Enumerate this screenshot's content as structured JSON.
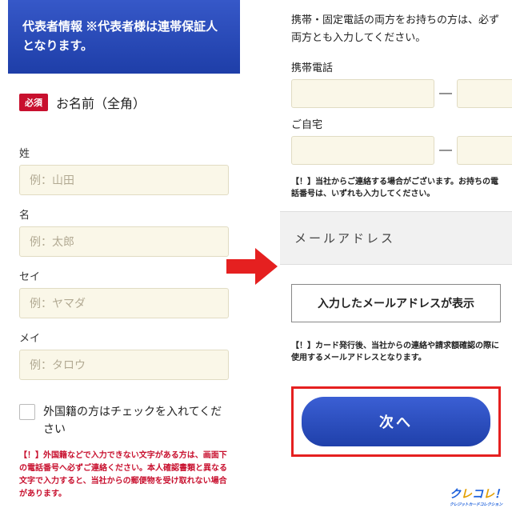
{
  "left": {
    "header": "代表者情報 ※代表者様は連帯保証人となります。",
    "required_badge": "必須",
    "section_title": "お名前（全角）",
    "fields": {
      "sei": {
        "label": "姓",
        "placeholder": "例：山田"
      },
      "mei": {
        "label": "名",
        "placeholder": "例：太郎"
      },
      "seikana": {
        "label": "セイ",
        "placeholder": "例：ヤマダ"
      },
      "meikana": {
        "label": "メイ",
        "placeholder": "例：タロウ"
      }
    },
    "checkbox_label": "外国籍の方はチェックを入れてください",
    "warning": "【！】外国籍などで入力できない文字がある方は、画面下の電話番号へ必ずご連絡ください。本人確認書類と異なる文字で入力すると、当社からの郵便物を受け取れない場合があります。"
  },
  "right": {
    "note": "携帯・固定電話の両方をお持ちの方は、必ず両方とも入力してください。",
    "mobile_label": "携帯電話",
    "home_label": "ご自宅",
    "dash": "—",
    "phone_warning": "【！】当社からご連絡する場合がございます。お持ちの電話番号は、いずれも入力してください。",
    "email_section": "メールアドレス",
    "email_display": "入力したメールアドレスが表示",
    "email_warning": "【！】カード発行後、当社からの連絡や請求額確認の際に使用するメールアドレスとなります。",
    "next_button": "次へ"
  },
  "logo": {
    "main": "クレコレ！",
    "sub": "クレジットカードコレクション"
  }
}
